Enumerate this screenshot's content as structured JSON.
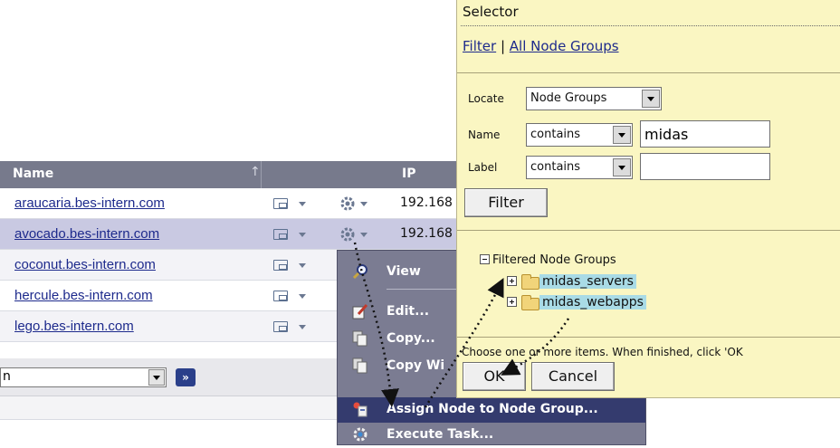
{
  "grid": {
    "headers": {
      "name": "Name",
      "sort_glyph": "↑",
      "ip": "IP"
    },
    "rows": [
      {
        "host": "araucaria.bes-intern.com",
        "ip": "192.168"
      },
      {
        "host": "avocado.bes-intern.com",
        "ip": "192.168"
      },
      {
        "host": "coconut.bes-intern.com"
      },
      {
        "host": "hercule.bes-intern.com"
      },
      {
        "host": "lego.bes-intern.com"
      }
    ],
    "footer": {
      "dropdown_value": "n",
      "go_label": "»"
    }
  },
  "context_menu": {
    "items": [
      {
        "label": "View",
        "icon": "view-icon"
      },
      {
        "label": "Edit...",
        "icon": "edit-icon"
      },
      {
        "label": "Copy...",
        "icon": "copy-icon"
      },
      {
        "label": "Copy Wi",
        "icon": "copy-with-icon"
      },
      {
        "label": "Assign Node to Node Group...",
        "icon": "assign-group-icon"
      },
      {
        "label": "Execute Task...",
        "icon": "execute-task-icon"
      }
    ],
    "highlighted_item": "Assign Node to Node Group..."
  },
  "selector": {
    "title": "Selector",
    "links": {
      "filter": "Filter",
      "separator": "|",
      "all": "All Node Groups"
    },
    "locate": {
      "label": "Locate",
      "value": "Node Groups"
    },
    "name": {
      "label": "Name",
      "operator": "contains",
      "value": "midas"
    },
    "label_field": {
      "label": "Label",
      "operator": "contains",
      "value": ""
    },
    "filter_button": "Filter",
    "tree": {
      "root": "Filtered Node Groups",
      "items": [
        "midas_servers",
        "midas_webapps"
      ]
    },
    "hint": "Choose one or more items. When finished, click 'OK",
    "ok_button": "OK",
    "cancel_button": "Cancel"
  },
  "colors": {
    "grid_header": "#777a8c",
    "selected_row": "#c9c9e2",
    "menu_bg": "#7b7c92",
    "menu_highlight": "#343b6e",
    "panel_bg": "#faf6c2",
    "tree_highlight": "#a9dbe6",
    "link": "#1d2a8c"
  }
}
